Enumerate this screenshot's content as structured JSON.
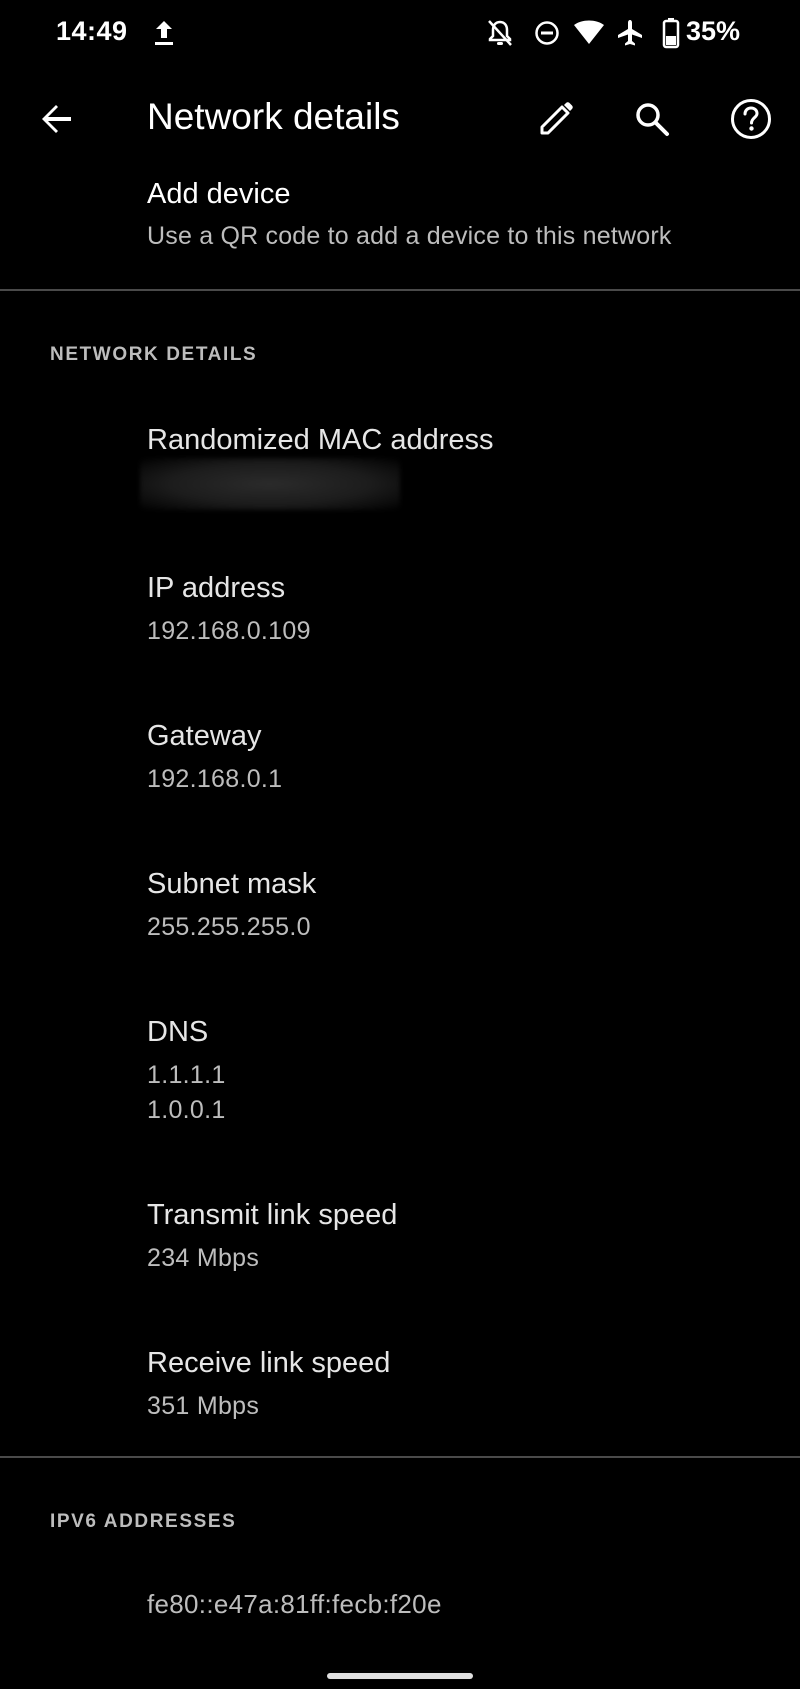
{
  "status_bar": {
    "time": "14:49",
    "battery_percent": "35%",
    "icons": [
      "upload-icon",
      "notifications-off-icon",
      "do-not-disturb-icon",
      "wifi-icon",
      "airplane-mode-icon",
      "battery-icon"
    ]
  },
  "app_bar": {
    "title": "Network details",
    "icons": [
      "back-arrow-icon",
      "edit-pencil-icon",
      "search-icon",
      "help-icon"
    ]
  },
  "add_device": {
    "title": "Add device",
    "subtitle": "Use a QR code to add a device to this network"
  },
  "network_details": {
    "header": "NETWORK DETAILS",
    "items": [
      {
        "label": "Randomized MAC address",
        "value": ""
      },
      {
        "label": "IP address",
        "value": "192.168.0.109"
      },
      {
        "label": "Gateway",
        "value": "192.168.0.1"
      },
      {
        "label": "Subnet mask",
        "value": "255.255.255.0"
      },
      {
        "label": "DNS",
        "values": [
          "1.1.1.1",
          "1.0.0.1"
        ]
      },
      {
        "label": "Transmit link speed",
        "value": "234 Mbps"
      },
      {
        "label": "Receive link speed",
        "value": "351 Mbps"
      }
    ]
  },
  "ipv6": {
    "header": "IPV6 ADDRESSES",
    "addresses": [
      "fe80::e47a:81ff:fecb:f20e"
    ]
  },
  "colors": {
    "background": "#000000",
    "primary_text": "#ffffff",
    "secondary_text": "#bdbdbd",
    "divider": "#4a4a4a"
  }
}
